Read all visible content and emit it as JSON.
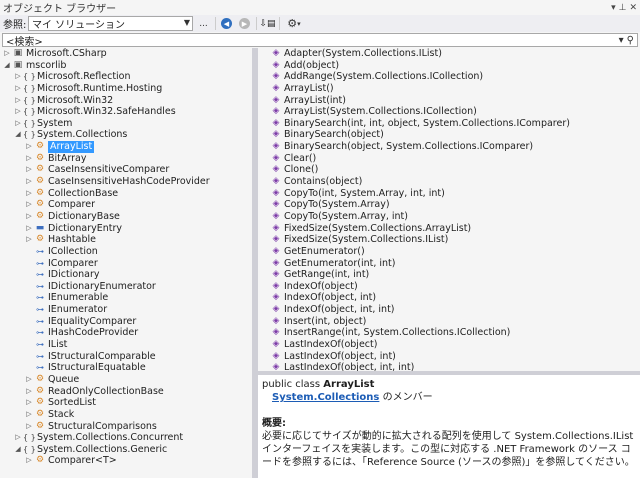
{
  "window": {
    "title": "オブジェクト ブラウザー"
  },
  "toolbar": {
    "scope_label": "参照:",
    "scope_value": "マイ ソリューション",
    "more_label": "..."
  },
  "search": {
    "placeholder": "<検索>"
  },
  "tree": [
    {
      "indent": 0,
      "twisty": "▷",
      "icon": "asm",
      "label": "Microsoft.CSharp"
    },
    {
      "indent": 0,
      "twisty": "◢",
      "icon": "asm",
      "label": "mscorlib"
    },
    {
      "indent": 1,
      "twisty": "▷",
      "icon": "ns",
      "label": "Microsoft.Reflection"
    },
    {
      "indent": 1,
      "twisty": "▷",
      "icon": "ns",
      "label": "Microsoft.Runtime.Hosting"
    },
    {
      "indent": 1,
      "twisty": "▷",
      "icon": "ns",
      "label": "Microsoft.Win32"
    },
    {
      "indent": 1,
      "twisty": "▷",
      "icon": "ns",
      "label": "Microsoft.Win32.SafeHandles"
    },
    {
      "indent": 1,
      "twisty": "▷",
      "icon": "ns",
      "label": "System"
    },
    {
      "indent": 1,
      "twisty": "◢",
      "icon": "ns",
      "label": "System.Collections"
    },
    {
      "indent": 2,
      "twisty": "▷",
      "icon": "cls",
      "label": "ArrayList",
      "selected": true
    },
    {
      "indent": 2,
      "twisty": "▷",
      "icon": "cls",
      "label": "BitArray"
    },
    {
      "indent": 2,
      "twisty": "▷",
      "icon": "cls",
      "label": "CaseInsensitiveComparer"
    },
    {
      "indent": 2,
      "twisty": "▷",
      "icon": "cls",
      "label": "CaseInsensitiveHashCodeProvider"
    },
    {
      "indent": 2,
      "twisty": "▷",
      "icon": "cls",
      "label": "CollectionBase"
    },
    {
      "indent": 2,
      "twisty": "▷",
      "icon": "cls",
      "label": "Comparer"
    },
    {
      "indent": 2,
      "twisty": "▷",
      "icon": "cls",
      "label": "DictionaryBase"
    },
    {
      "indent": 2,
      "twisty": "▷",
      "icon": "struct",
      "label": "DictionaryEntry"
    },
    {
      "indent": 2,
      "twisty": "▷",
      "icon": "cls",
      "label": "Hashtable"
    },
    {
      "indent": 2,
      "twisty": "",
      "icon": "intf",
      "label": "ICollection"
    },
    {
      "indent": 2,
      "twisty": "",
      "icon": "intf",
      "label": "IComparer"
    },
    {
      "indent": 2,
      "twisty": "",
      "icon": "intf",
      "label": "IDictionary"
    },
    {
      "indent": 2,
      "twisty": "",
      "icon": "intf",
      "label": "IDictionaryEnumerator"
    },
    {
      "indent": 2,
      "twisty": "",
      "icon": "intf",
      "label": "IEnumerable"
    },
    {
      "indent": 2,
      "twisty": "",
      "icon": "intf",
      "label": "IEnumerator"
    },
    {
      "indent": 2,
      "twisty": "",
      "icon": "intf",
      "label": "IEqualityComparer"
    },
    {
      "indent": 2,
      "twisty": "",
      "icon": "intf",
      "label": "IHashCodeProvider"
    },
    {
      "indent": 2,
      "twisty": "",
      "icon": "intf",
      "label": "IList"
    },
    {
      "indent": 2,
      "twisty": "",
      "icon": "intf",
      "label": "IStructuralComparable"
    },
    {
      "indent": 2,
      "twisty": "",
      "icon": "intf",
      "label": "IStructuralEquatable"
    },
    {
      "indent": 2,
      "twisty": "▷",
      "icon": "cls",
      "label": "Queue"
    },
    {
      "indent": 2,
      "twisty": "▷",
      "icon": "cls",
      "label": "ReadOnlyCollectionBase"
    },
    {
      "indent": 2,
      "twisty": "▷",
      "icon": "cls",
      "label": "SortedList"
    },
    {
      "indent": 2,
      "twisty": "▷",
      "icon": "cls",
      "label": "Stack"
    },
    {
      "indent": 2,
      "twisty": "▷",
      "icon": "cls",
      "label": "StructuralComparisons"
    },
    {
      "indent": 1,
      "twisty": "▷",
      "icon": "ns",
      "label": "System.Collections.Concurrent"
    },
    {
      "indent": 1,
      "twisty": "◢",
      "icon": "ns",
      "label": "System.Collections.Generic"
    },
    {
      "indent": 2,
      "twisty": "▷",
      "icon": "cls",
      "label": "Comparer<T>"
    }
  ],
  "members": [
    "Adapter(System.Collections.IList)",
    "Add(object)",
    "AddRange(System.Collections.ICollection)",
    "ArrayList()",
    "ArrayList(int)",
    "ArrayList(System.Collections.ICollection)",
    "BinarySearch(int, int, object, System.Collections.IComparer)",
    "BinarySearch(object)",
    "BinarySearch(object, System.Collections.IComparer)",
    "Clear()",
    "Clone()",
    "Contains(object)",
    "CopyTo(int, System.Array, int, int)",
    "CopyTo(System.Array)",
    "CopyTo(System.Array, int)",
    "FixedSize(System.Collections.ArrayList)",
    "FixedSize(System.Collections.IList)",
    "GetEnumerator()",
    "GetEnumerator(int, int)",
    "GetRange(int, int)",
    "IndexOf(object)",
    "IndexOf(object, int)",
    "IndexOf(object, int, int)",
    "Insert(int, object)",
    "InsertRange(int, System.Collections.ICollection)",
    "LastIndexOf(object)",
    "LastIndexOf(object, int)",
    "LastIndexOf(object, int, int)"
  ],
  "description": {
    "decl_prefix": "public class ",
    "decl_name": "ArrayList",
    "member_of_link": "System.Collections",
    "member_of_suffix": " のメンバー",
    "summary_label": "概要:",
    "summary_text": "必要に応じてサイズが動的に拡大される配列を使用して System.Collections.IList インターフェイスを実装します。この型に対応する .NET Framework のソース コードを参照するには、「Reference Source (ソースの参照)」を参照してください。"
  }
}
